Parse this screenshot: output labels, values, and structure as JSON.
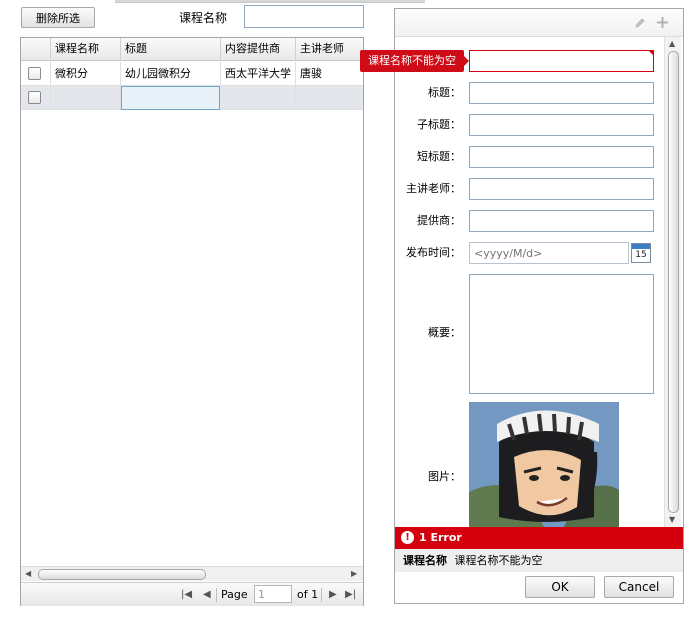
{
  "toolbar": {
    "delete_selected_label": "删除所选",
    "search_label": "课程名称",
    "search_value": ""
  },
  "grid": {
    "columns": [
      "课程名称",
      "标题",
      "内容提供商",
      "主讲老师"
    ],
    "rows": [
      [
        "微积分",
        "幼儿园微积分",
        "西太平洋大学",
        "唐骏"
      ],
      [
        "",
        "",
        "",
        ""
      ]
    ]
  },
  "pager": {
    "page_label": "Page",
    "page_value": "1",
    "of_label": "of 1"
  },
  "form": {
    "fields": [
      {
        "label": "标题：",
        "value": ""
      },
      {
        "label": "子标题：",
        "value": ""
      },
      {
        "label": "短标题：",
        "value": ""
      },
      {
        "label": "主讲老师：",
        "value": ""
      },
      {
        "label": "提供商：",
        "value": ""
      },
      {
        "label": "发布时间：",
        "placeholder": "<yyyy/M/d>"
      }
    ],
    "summary_label": "概要：",
    "image_label": "图片：",
    "course_name_value": "",
    "calendar_day": "15"
  },
  "validation": {
    "tooltip": "课程名称不能为空",
    "error_count": "1 Error",
    "error_field": "课程名称",
    "error_message": "课程名称不能为空"
  },
  "buttons": {
    "ok_label": "OK",
    "cancel_label": "Cancel"
  },
  "colors": {
    "error_red": "#d4000e",
    "border_blue": "#8fa6bd"
  },
  "icons": {
    "edit": "pencil-icon",
    "add": "plus-icon",
    "calendar": "calendar-icon",
    "error": "error-icon"
  }
}
